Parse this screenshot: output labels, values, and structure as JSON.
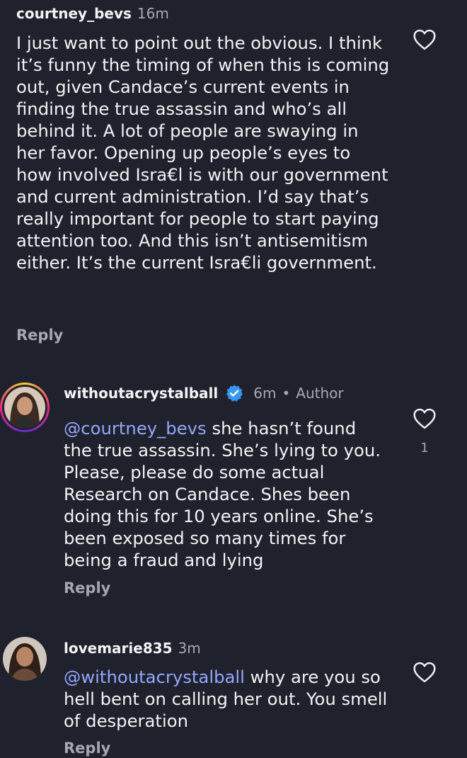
{
  "comments": [
    {
      "username": "courtney_bevs",
      "time": "16m",
      "text": "I just want to point out the obvious. I think it’s funny the timing of when this is coming out, given Candace’s current events in finding the true assassin and who’s all behind it. A lot of people are swaying in her favor. Opening up people’s eyes to how involved Isra€l is with our government and current administration. I’d say that’s really important for people to start paying attention too. And this isn’t antisemitism either. It’s the current Isra€li government.",
      "reply_label": "Reply"
    },
    {
      "username": "withoutacrystalball",
      "time": "6m",
      "separator": "•",
      "author_label": "Author",
      "mention": "@courtney_bevs",
      "text": " she hasn’t found the true assassin. She’s lying to you. Please, please do some actual Research on Candace. Shes been doing this for 10 years online. She’s been exposed so many times for being a fraud and lying",
      "likes": "1",
      "reply_label": "Reply"
    },
    {
      "username": "lovemarie835",
      "time": "3m",
      "mention": "@withoutacrystalball",
      "text": " why are you so hell bent on calling her out. You smell of desperation",
      "reply_label": "Reply"
    }
  ],
  "icons": {
    "like": "heart-outline-icon",
    "verified": "verified-badge-icon"
  },
  "colors": {
    "background": "#1f222c",
    "mention": "#95a7ff",
    "secondary_text": "#a4a8b1",
    "verified": "#3897f0"
  }
}
